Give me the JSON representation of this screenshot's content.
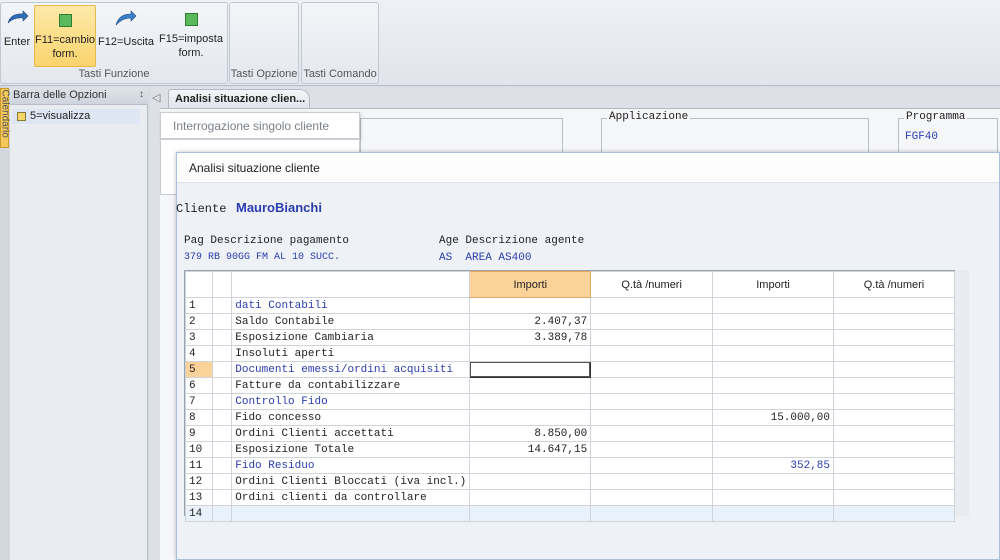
{
  "ribbon": {
    "enter_label": "Enter",
    "f11_label": "F11=cambio form.",
    "f12_label": "F12=Uscita",
    "f15_label": "F15=imposta form.",
    "group_funzione": "Tasti Funzione",
    "group_opzione": "Tasti Opzione",
    "group_comando": "Tasti Comando"
  },
  "options_panel": {
    "side_tab": "Calendario",
    "title": "Barra delle Opzioni",
    "items": [
      {
        "label": "5=visualizza"
      }
    ]
  },
  "document_tab": {
    "label": "Analisi situazione clien..."
  },
  "background_form": {
    "menu_item": "Interrogazione singolo cliente",
    "applicazione_label": "Applicazione",
    "programma_label": "Programma",
    "programma_value": "FGF40"
  },
  "dialog": {
    "title": "Analisi situazione cliente",
    "cliente_label": "Cliente",
    "cliente_name": "MauroBianchi",
    "pag_header": "Pag Descrizione pagamento",
    "pag_value": "379 RB 90GG FM AL 10 SUCC.",
    "age_header": "Age Descrizione agente",
    "age_value": "AS  AREA AS400",
    "grid": {
      "columns": [
        "Importi",
        "Q.tà /numeri",
        "Importi",
        "Q.tà /numeri"
      ],
      "rows": [
        {
          "n": "1",
          "desc": "dati Contabili",
          "c1": "",
          "c2": "",
          "c3": "",
          "c4": ""
        },
        {
          "n": "2",
          "desc": "Saldo Contabile",
          "c1": "2.407,37",
          "c2": "",
          "c3": "",
          "c4": ""
        },
        {
          "n": "3",
          "desc": "Esposizione Cambiaria",
          "c1": "3.389,78",
          "c2": "",
          "c3": "",
          "c4": ""
        },
        {
          "n": "4",
          "desc": "Insoluti aperti",
          "c1": "",
          "c2": "",
          "c3": "",
          "c4": ""
        },
        {
          "n": "5",
          "desc": "Documenti emessi/ordini acquisiti",
          "c1": "",
          "c2": "",
          "c3": "",
          "c4": ""
        },
        {
          "n": "6",
          "desc": "Fatture da contabilizzare",
          "c1": "",
          "c2": "",
          "c3": "",
          "c4": ""
        },
        {
          "n": "7",
          "desc": "Controllo Fido",
          "c1": "",
          "c2": "",
          "c3": "",
          "c4": ""
        },
        {
          "n": "8",
          "desc": "Fido concesso",
          "c1": "",
          "c2": "",
          "c3": "15.000,00",
          "c4": ""
        },
        {
          "n": "9",
          "desc": "Ordini Clienti accettati",
          "c1": "8.850,00",
          "c2": "",
          "c3": "",
          "c4": ""
        },
        {
          "n": "10",
          "desc": "Esposizione Totale",
          "c1": "14.647,15",
          "c2": "",
          "c3": "",
          "c4": ""
        },
        {
          "n": "11",
          "desc": "Fido Residuo",
          "c1": "",
          "c2": "",
          "c3": "352,85",
          "c4": ""
        },
        {
          "n": "12",
          "desc": "Ordini Clienti Bloccati (iva incl.)",
          "c1": "",
          "c2": "",
          "c3": "",
          "c4": ""
        },
        {
          "n": "13",
          "desc": "Ordini clienti da controllare",
          "c1": "",
          "c2": "",
          "c3": "",
          "c4": ""
        },
        {
          "n": "14",
          "desc": "",
          "c1": "",
          "c2": "",
          "c3": "",
          "c4": ""
        }
      ]
    }
  },
  "colors": {
    "accent_blue": "#2a3eb0",
    "selection_orange": "#fcd29b",
    "ribbon_active": "#fbd46e"
  }
}
